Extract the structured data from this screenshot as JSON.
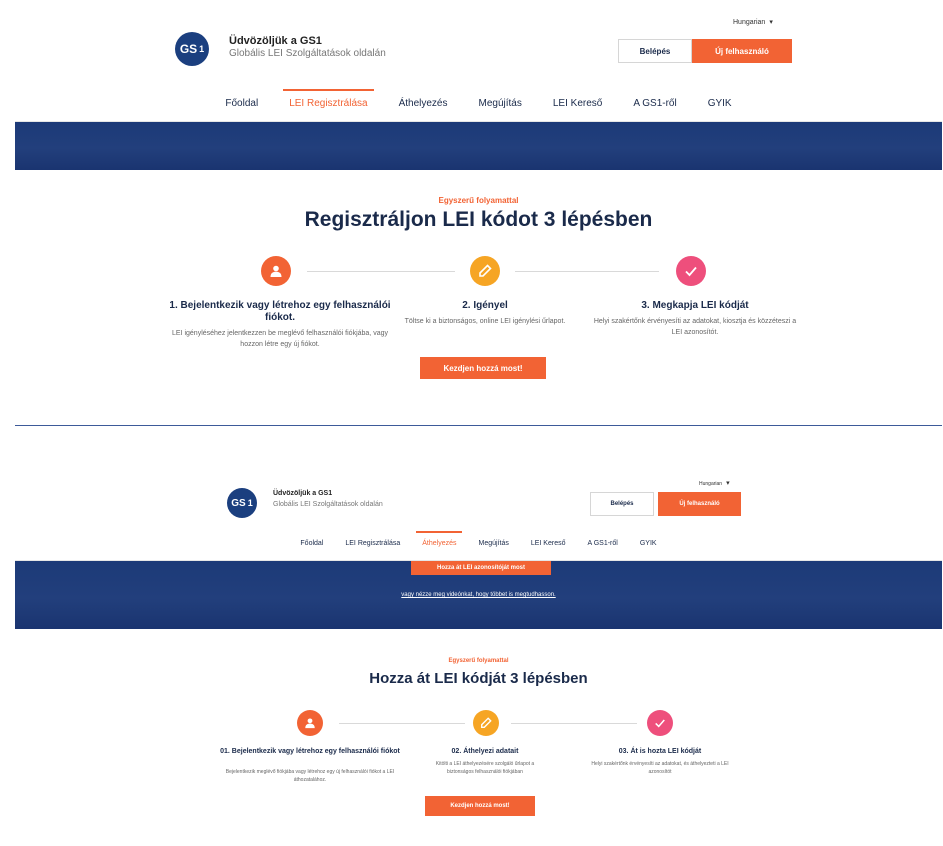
{
  "colors": {
    "accent": "#f26334",
    "navy": "#1c3a78",
    "step1": "#f26334",
    "step2": "#f6a524",
    "step3": "#ee4f7c"
  },
  "panel1": {
    "logo": {
      "text": "GS",
      "sub": "1"
    },
    "brand_title": "Üdvözöljük a GS1",
    "brand_subtitle": "Globális LEI Szolgáltatások oldalán",
    "language": "Hungarian",
    "login_label": "Belépés",
    "new_user_label": "Új felhasználó",
    "nav": [
      "Főoldal",
      "LEI Regisztrálása",
      "Áthelyezés",
      "Megújítás",
      "LEI Kereső",
      "A GS1-ről",
      "GYIK"
    ],
    "eyebrow": "Egyszerű folyamattal",
    "heading": "Regisztráljon LEI kódot 3 lépésben",
    "steps": [
      {
        "icon": "user-icon",
        "title": "1. Bejelentkezik vagy létrehoz egy felhasználói fiókot.",
        "desc": "LEI igényléséhez jelentkezzen be meglévő felhasználói fiókjába, vagy hozzon létre egy új fiókot."
      },
      {
        "icon": "pencil-icon",
        "title": "2. Igényel",
        "desc": "Töltse ki a biztonságos, online LEI igénylési űrlapot."
      },
      {
        "icon": "check-icon",
        "title": "3. Megkapja LEI kódját",
        "desc": "Helyi szakértőnk érvényesíti az adatokat, kiosztja és közzéteszi a LEI azonosítót."
      }
    ],
    "cta_label": "Kezdjen hozzá most!"
  },
  "panel2": {
    "logo": {
      "text": "GS",
      "sub": "1"
    },
    "brand_title": "Üdvözöljük a GS1",
    "brand_subtitle": "Globális LEI Szolgáltatások oldalán",
    "language": "Hungarian",
    "login_label": "Belépés",
    "new_user_label": "Új felhasználó",
    "nav": [
      "Főoldal",
      "LEI Regisztrálása",
      "Áthelyezés",
      "Megújítás",
      "LEI Kereső",
      "A GS1-ről",
      "GYIK"
    ],
    "band_cta_label": "Hozza át LEI azonosítóját most",
    "band_link": "vagy nézze meg videónkat, hogy többet is megtudhasson.",
    "eyebrow": "Egyszerű folyamattal",
    "heading": "Hozza át LEI kódját 3 lépésben",
    "steps": [
      {
        "icon": "user-icon",
        "title": "01. Bejelentkezik vagy létrehoz egy felhasználói fiókot",
        "desc": "Bejelentkezik meglévő fiókjába vagy létrehoz egy új felhasználói fiókot a LEI áthozatalához."
      },
      {
        "icon": "pencil-icon",
        "title": "02. Áthelyezi adatait",
        "desc": "Kitölti a LEI áthelyezésére szolgáló űrlapot a biztonságos felhasználói fiókjában"
      },
      {
        "icon": "check-icon",
        "title": "03. Át is hozta LEI kódját",
        "desc": "Helyi szakértőnk érvényesíti az adatokat, és áthelyezteti a LEI azonosítót"
      }
    ],
    "cta_label": "Kezdjen hozzá most!"
  }
}
